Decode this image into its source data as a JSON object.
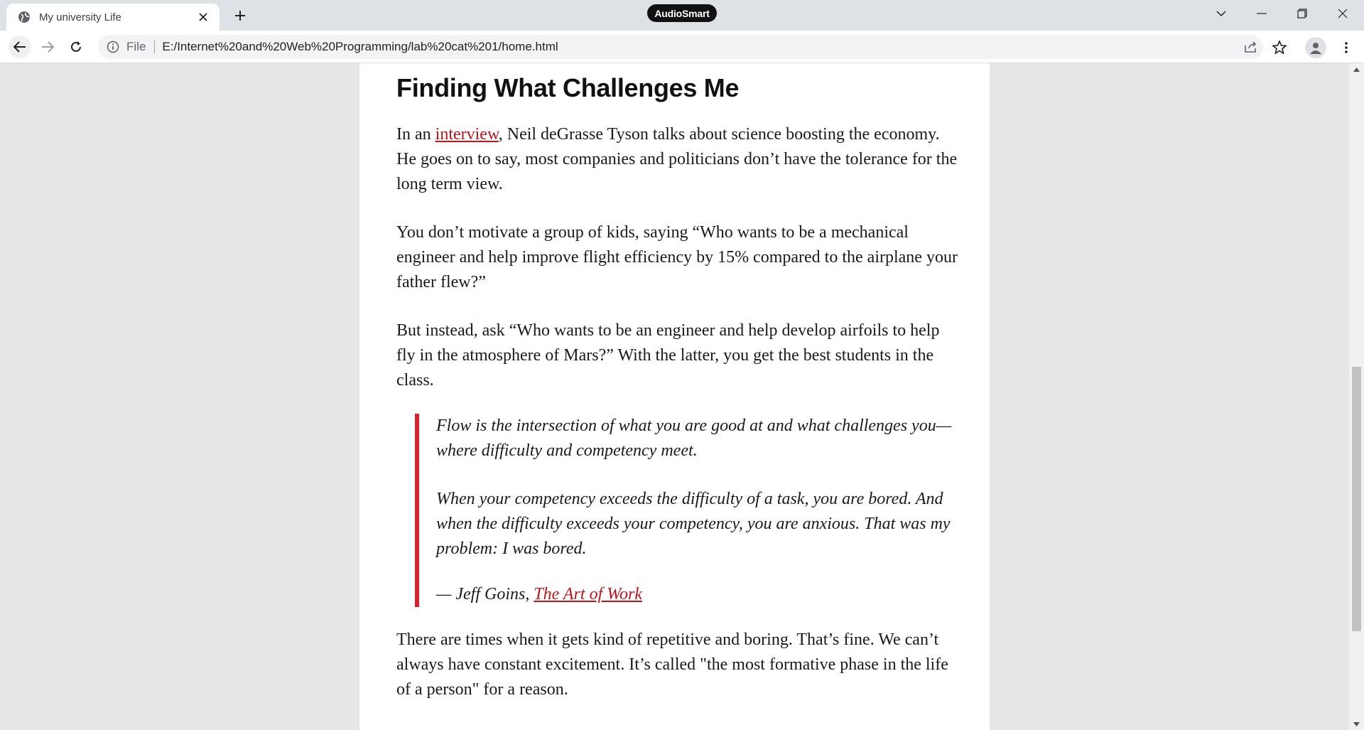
{
  "browser": {
    "tab_title": "My university Life",
    "badge": "AudioSmart",
    "scheme": "File",
    "url": "E:/Internet%20and%20Web%20Programming/lab%20cat%201/home.html"
  },
  "article": {
    "heading": "Finding What Challenges Me",
    "p1": {
      "before": "In an ",
      "link": "interview",
      "after": ", Neil deGrasse Tyson talks about science boosting the economy. He goes on to say, most companies and politicians don’t have the tolerance for the long term view."
    },
    "p2": "You don’t motivate a group of kids, saying “Who wants to be a mechanical engineer and help improve flight efficiency by 15% compared to the airplane your father flew?”",
    "p3": "But instead, ask “Who wants to be an engineer and help develop airfoils to help fly in the atmosphere of Mars?” With the latter, you get the best students in the class.",
    "quote": {
      "line1": "Flow is the intersection of what you are good at and what challenges you— where difficulty and competency meet.",
      "line2": "When your competency exceeds the difficulty of a task, you are bored. And when the difficulty exceeds your competency, you are anxious. That was my problem: I was bored.",
      "attribution": "— Jeff Goins, ",
      "book": "The Art of Work"
    },
    "p4": "There are times when it gets kind of repetitive and boring. That’s fine. We can’t always have constant excitement. It’s called \"the most formative phase in the life of a person\" for a reason."
  },
  "colors": {
    "link": "#c0141c",
    "quote_border": "#d4232b"
  }
}
